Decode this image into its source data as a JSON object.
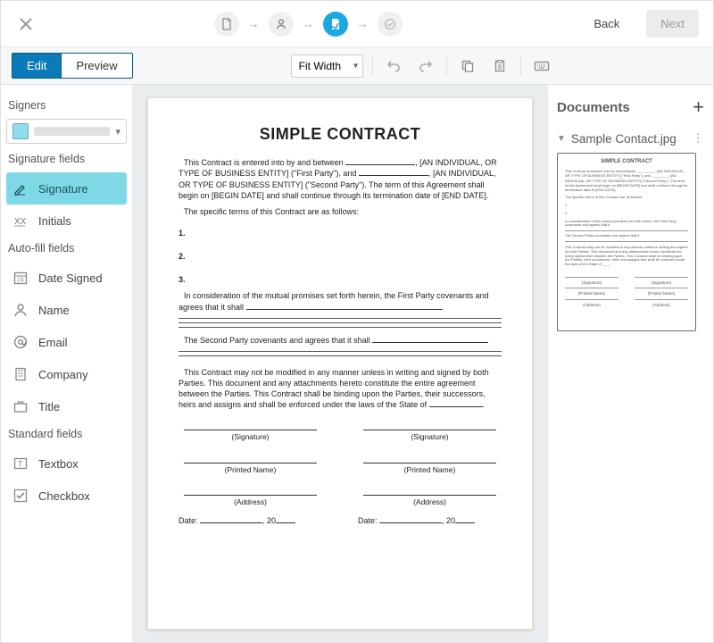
{
  "topbar": {
    "back": "Back",
    "next": "Next"
  },
  "toolbar": {
    "edit": "Edit",
    "preview": "Preview",
    "zoom": "Fit Width"
  },
  "left": {
    "signers_label": "Signers",
    "sigfields_label": "Signature fields",
    "autofill_label": "Auto-fill fields",
    "stdfields_label": "Standard fields",
    "signature": "Signature",
    "initials": "Initials",
    "date_signed": "Date Signed",
    "name": "Name",
    "email": "Email",
    "company": "Company",
    "title": "Title",
    "textbox": "Textbox",
    "checkbox": "Checkbox"
  },
  "doc": {
    "title": "SIMPLE CONTRACT",
    "intro_a": "This Contract is entered into by and between ",
    "intro_b": ", [AN INDIVIDUAL, OR TYPE OF BUSINESS ENTITY] (\"First Party\"), and ",
    "intro_c": ", [AN INDIVIDUAL, OR TYPE OF BUSINESS ENTITY] (\"Second Party\").   The term of this Agreement shall begin on [BEGIN DATE] and shall continue through its termination date of [END DATE].",
    "terms_label": "The specific terms of this Contract are as follows:",
    "n1": "1.",
    "n2": "2.",
    "n3": "3.",
    "consideration": "In consideration of the mutual promises set forth herein, the First Party covenants and agrees that it shall ",
    "second_party": "The Second Party covenants and agrees that it shall ",
    "mod": "This Contract may not be modified in any manner unless in writing and signed by both Parties. This document and any attachments hereto constitute the entire agreement between the Parties.  This Contract shall be binding upon the Parties, their successors, heirs and assigns and shall be enforced under the laws of the State of ",
    "mod_tail": ".",
    "sig": "(Signature)",
    "pname": "(Printed Name)",
    "addr": "(Address)",
    "date": "Date: ",
    "twenty": ", 20"
  },
  "right": {
    "heading": "Documents",
    "doc_name": "Sample Contact.jpg"
  }
}
